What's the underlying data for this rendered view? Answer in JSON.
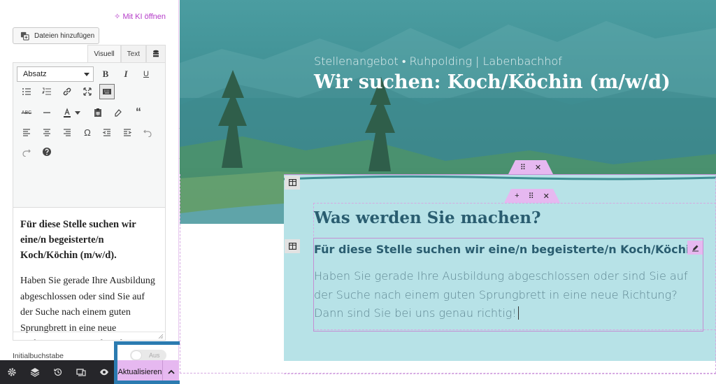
{
  "editor_panel": {
    "ai_link": "✧ Mit KI öffnen",
    "add_files_label": "Dateien hinzufügen",
    "tabs": {
      "visual": "Visuell",
      "text": "Text"
    },
    "format_select": "Absatz",
    "content": {
      "bold_text": "Für diese Stelle suchen wir eine/n begeisterte/n Koch/Köchin (m/w/d).",
      "paragraph": "Haben Sie gerade Ihre Ausbildung abgeschlossen oder sind Sie auf der Suche nach einem guten Sprungbrett in eine neue Richtung? Dann sind Sie bei uns genau richtig!"
    },
    "initial_letter_label": "Initialbuchstabe",
    "toggle_state": "Aus",
    "update_button": "Aktualisieren"
  },
  "preview": {
    "hero": {
      "subtitle": "Stellenangebot • Ruhpolding | Labenbachhof",
      "title": "Wir suchen: Koch/Köchin (m/w/d)"
    },
    "section": {
      "heading": "Was werden Sie machen?",
      "bold_text": "Für diese Stelle suchen wir eine/n begeisterte/n Koch/Köchin (m/w/d).",
      "paragraph": "Haben Sie gerade Ihre Ausbildung abgeschlossen oder sind Sie auf der Suche nach einem guten Sprungbrett in eine neue Richtung? Dann sind Sie bei uns genau richtig!"
    }
  },
  "colors": {
    "accent": "#e6b8f0",
    "ai_link": "#b43cc8",
    "hero_teal": "#3f8f93",
    "section_bg": "#b7e2e7",
    "heading": "#2a5d70",
    "focus_outline": "#2b7bb0",
    "bottom_bar": "#26262a"
  },
  "icons": {
    "bottom_bar": [
      "gear-icon",
      "layers-icon",
      "history-icon",
      "responsive-icon",
      "eye-icon"
    ],
    "toolbar": [
      "bold-icon",
      "italic-icon",
      "underline-icon",
      "bullet-list-icon",
      "numbered-list-icon",
      "link-icon",
      "fullscreen-icon",
      "keyboard-icon",
      "strikethrough-icon",
      "horizontal-line-icon",
      "text-color-icon",
      "paste-text-icon",
      "clear-formatting-icon",
      "blockquote-icon",
      "align-left-icon",
      "align-center-icon",
      "align-right-icon",
      "omega-icon",
      "outdent-icon",
      "indent-icon",
      "undo-icon",
      "redo-icon",
      "help-icon"
    ]
  }
}
